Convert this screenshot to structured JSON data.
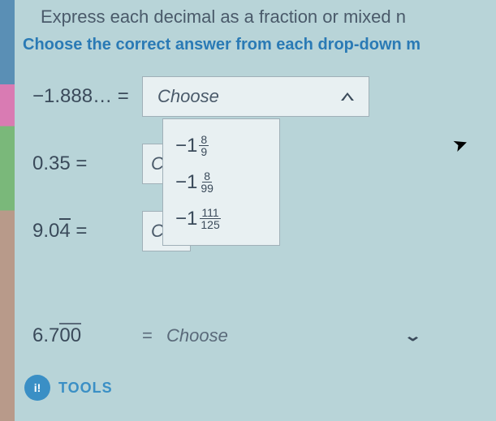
{
  "header": {
    "title_partial": "Express each decimal as a fraction or mixed n",
    "instruction_partial": "Choose the correct answer from each drop-down m"
  },
  "problems": {
    "row1": {
      "decimal": "−1.888… =",
      "placeholder": "Choose"
    },
    "row2": {
      "decimal": "0.35 =",
      "placeholder_partial": "Cho"
    },
    "row3": {
      "decimal_prefix": "9.0",
      "decimal_overline": "4",
      "decimal_suffix": " =",
      "placeholder_partial": "Cho"
    },
    "row4": {
      "decimal_prefix": "6.7",
      "decimal_overline": "00",
      "eq": "=",
      "placeholder_partial": "Choose"
    }
  },
  "dropdown_options": {
    "opt1": {
      "whole": "−1",
      "num": "8",
      "den": "9"
    },
    "opt2": {
      "whole": "−1",
      "num": "8",
      "den": "99"
    },
    "opt3": {
      "whole": "−1",
      "num": "111",
      "den": "125"
    }
  },
  "tools": {
    "icon_text": "i!",
    "label": "TOOLS"
  }
}
